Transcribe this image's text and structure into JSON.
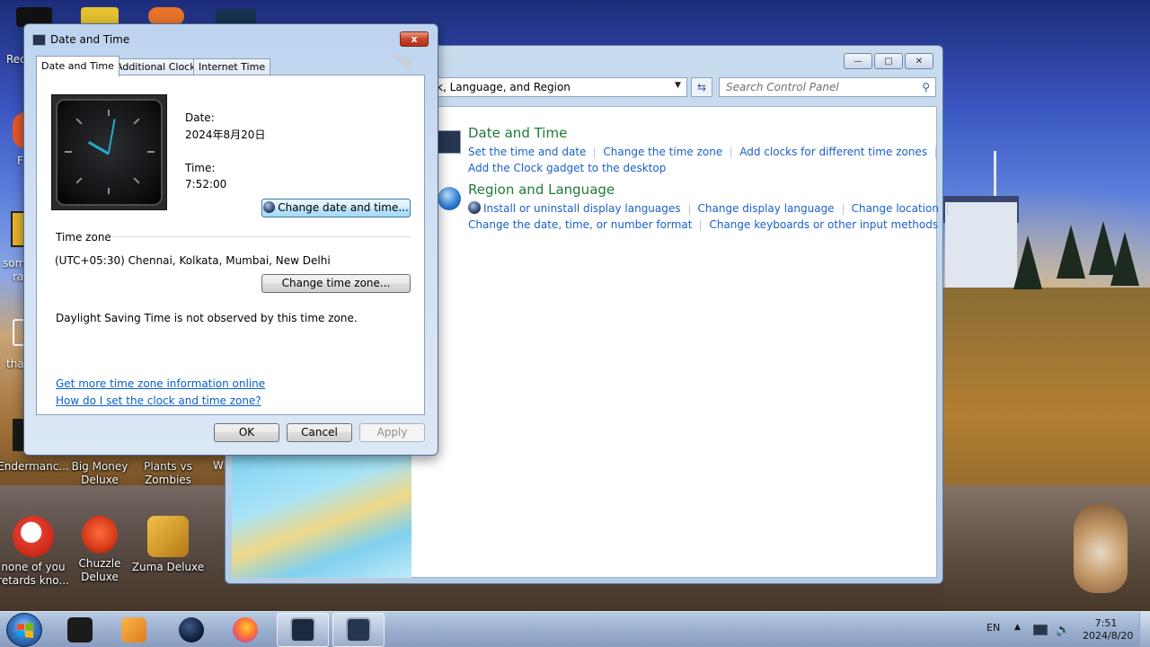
{
  "desktop": {
    "icons": [
      {
        "label": "Endermanc...",
        "img": "#3a3a3a"
      },
      {
        "label": "Big Money\nDeluxe",
        "img": "#d7b13a"
      },
      {
        "label": "Plants vs\nZombies",
        "img": "#6aa83a"
      },
      {
        "label": "none of you\nretards kno...",
        "img": "#e23a2a"
      },
      {
        "label": "Chuzzle\nDeluxe",
        "img": "#d63a1a"
      },
      {
        "label": "Zuma Deluxe",
        "img": "#d9a02a"
      }
    ],
    "partial_labels": [
      "Rec",
      "F",
      "som",
      "ra",
      "tha",
      "Wi"
    ]
  },
  "control_panel": {
    "address_text": "k, Language, and Region",
    "search_placeholder": "Search Control Panel",
    "categories": [
      {
        "title": "Date and Time",
        "icon": "calendar-clock-icon",
        "links_row1": [
          "Set the time and date",
          "Change the time zone",
          "Add clocks for different time zones"
        ],
        "links_row2": [
          "Add the Clock gadget to the desktop"
        ]
      },
      {
        "title": "Region and Language",
        "icon": "globe-icon",
        "links_row1": [
          "Install or uninstall display languages",
          "Change display language",
          "Change location"
        ],
        "links_row2": [
          "Change the date, time, or number format",
          "Change keyboards or other input methods"
        ]
      }
    ]
  },
  "dialog": {
    "title": "Date and Time",
    "close_label": "x",
    "tabs": [
      "Date and Time",
      "Additional Clocks",
      "Internet Time"
    ],
    "active_tab": "Date and Time",
    "date_label": "Date:",
    "date_value": "2024年8月20日",
    "time_label": "Time:",
    "time_value": "7:52:00",
    "change_date_button": "Change date and time...",
    "timezone_header": "Time zone",
    "timezone_value": "(UTC+05:30) Chennai, Kolkata, Mumbai, New Delhi",
    "change_timezone_button": "Change time zone...",
    "dst_text": "Daylight Saving Time is not observed by this time zone.",
    "link_more_info": "Get more time zone information online",
    "link_how": "How do I set the clock and time zone?",
    "ok": "OK",
    "cancel": "Cancel",
    "apply": "Apply"
  },
  "taskbar": {
    "language": "EN",
    "clock_time": "7:51",
    "clock_date": "2024/8/20",
    "apps": [
      "terminal-app-icon",
      "media-player-icon",
      "browser-globe-icon",
      "firefox-icon",
      "display-window-icon",
      "date-time-window-icon"
    ]
  }
}
